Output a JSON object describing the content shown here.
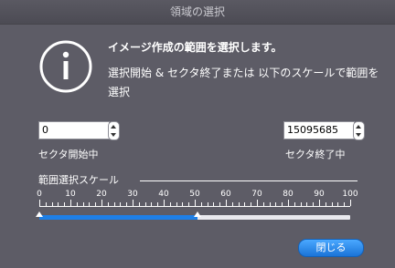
{
  "window": {
    "title": "領域の選択"
  },
  "dialog": {
    "icon": "info-icon",
    "heading": "イメージ作成の範囲を選択します。",
    "message": "選択開始 & セクタ終了または 以下のスケールで範囲を選択"
  },
  "start_sector": {
    "value": "0",
    "label": "セクタ開始中"
  },
  "end_sector": {
    "value": "15095685",
    "label": "セクタ終了中"
  },
  "scale": {
    "title": "範囲選択スケール",
    "ticks": [
      "0",
      "10",
      "20",
      "30",
      "40",
      "50",
      "60",
      "70",
      "80",
      "90",
      "100"
    ],
    "selection_start_percent": 0,
    "selection_end_percent": 51
  },
  "buttons": {
    "close": "閉じる"
  },
  "colors": {
    "background": "#5d5c66",
    "accent": "#1e7fe6"
  }
}
